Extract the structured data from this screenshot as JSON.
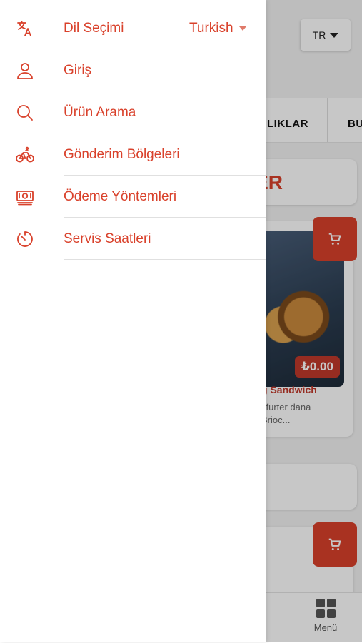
{
  "background": {
    "language_button": "TR",
    "categories": [
      "LIKLAR",
      "BU"
    ],
    "section_title": "LER",
    "product": {
      "price": "₺0.00",
      "name": "g Sandwich",
      "description": "kfurter dana\nBrioc..."
    },
    "bottom_nav": {
      "menu_label": "Menü"
    }
  },
  "drawer": {
    "language": {
      "label": "Dil Seçimi",
      "selected": "Turkish",
      "icon": "translate-icon"
    },
    "items": [
      {
        "label": "Giriş",
        "icon": "user-icon"
      },
      {
        "label": "Ürün Arama",
        "icon": "search-icon"
      },
      {
        "label": "Gönderim Bölgeleri",
        "icon": "bicycle-icon"
      },
      {
        "label": "Ödeme Yöntemleri",
        "icon": "cash-icon"
      },
      {
        "label": "Servis Saatleri",
        "icon": "timer-icon"
      }
    ]
  },
  "colors": {
    "accent": "#d9412b",
    "separator": "#e0e0e0"
  }
}
